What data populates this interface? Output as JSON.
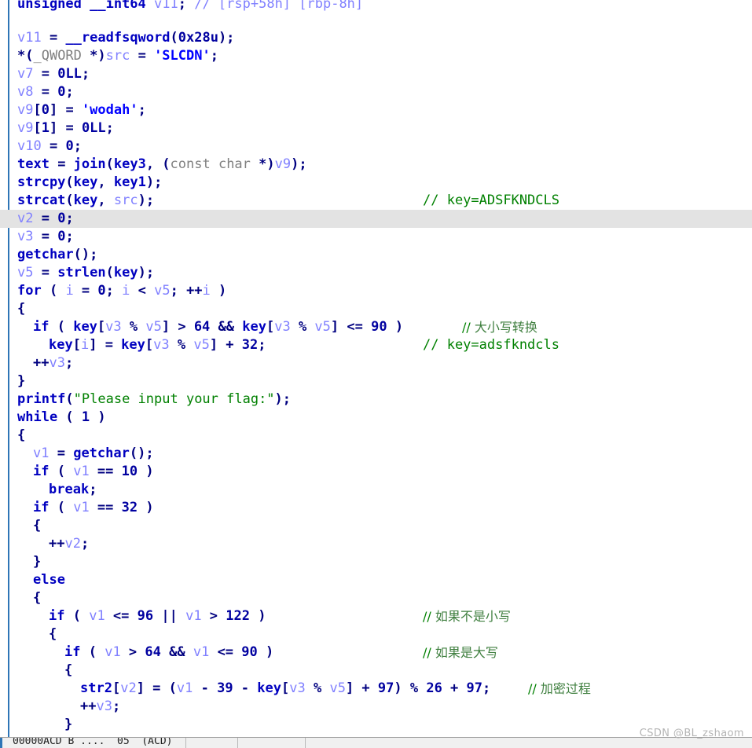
{
  "view": {
    "kind": "ida-pseudocode-pane",
    "highlighted_line_index": 11,
    "colors": {
      "background": "#ffffff",
      "highlight_row": "#e3e3e3",
      "left_rule": "#2e75b6",
      "keyword": "#0000c0",
      "local_variable": "#8080ff",
      "number": "#0000a0",
      "string": "#008000",
      "comment": "#008000",
      "type": "#808080",
      "punctuation": "#000080",
      "watermark": "#b4b4b4"
    }
  },
  "code_lines": [
    {
      "indent": 0,
      "clipped": true,
      "tokens": [
        {
          "t": "kw",
          "s": "unsigned __int64"
        },
        {
          "t": "pun",
          "s": " "
        },
        {
          "t": "var",
          "s": "v11"
        },
        {
          "t": "pun",
          "s": "; "
        },
        {
          "t": "cmtv",
          "s": "// [rsp+58h] [rbp-8h]"
        }
      ]
    },
    {
      "indent": 0,
      "tokens": []
    },
    {
      "indent": 0,
      "tokens": [
        {
          "t": "var",
          "s": "v11"
        },
        {
          "t": "pun",
          "s": " = "
        },
        {
          "t": "fn",
          "s": "__readfsqword"
        },
        {
          "t": "pun",
          "s": "("
        },
        {
          "t": "num",
          "s": "0x28u"
        },
        {
          "t": "pun",
          "s": ");"
        }
      ]
    },
    {
      "indent": 0,
      "tokens": [
        {
          "t": "pun",
          "s": "*("
        },
        {
          "t": "typ",
          "s": "_QWORD "
        },
        {
          "t": "pun",
          "s": "*)"
        },
        {
          "t": "var",
          "s": "src"
        },
        {
          "t": "pun",
          "s": " = "
        },
        {
          "t": "chr",
          "s": "'SLCDN'"
        },
        {
          "t": "pun",
          "s": ";"
        }
      ]
    },
    {
      "indent": 0,
      "tokens": [
        {
          "t": "var",
          "s": "v7"
        },
        {
          "t": "pun",
          "s": " = "
        },
        {
          "t": "num",
          "s": "0LL"
        },
        {
          "t": "pun",
          "s": ";"
        }
      ]
    },
    {
      "indent": 0,
      "tokens": [
        {
          "t": "var",
          "s": "v8"
        },
        {
          "t": "pun",
          "s": " = "
        },
        {
          "t": "num",
          "s": "0"
        },
        {
          "t": "pun",
          "s": ";"
        }
      ]
    },
    {
      "indent": 0,
      "tokens": [
        {
          "t": "var",
          "s": "v9"
        },
        {
          "t": "pun",
          "s": "["
        },
        {
          "t": "num",
          "s": "0"
        },
        {
          "t": "pun",
          "s": "] = "
        },
        {
          "t": "chr",
          "s": "'wodah'"
        },
        {
          "t": "pun",
          "s": ";"
        }
      ]
    },
    {
      "indent": 0,
      "tokens": [
        {
          "t": "var",
          "s": "v9"
        },
        {
          "t": "pun",
          "s": "["
        },
        {
          "t": "num",
          "s": "1"
        },
        {
          "t": "pun",
          "s": "] = "
        },
        {
          "t": "num",
          "s": "0LL"
        },
        {
          "t": "pun",
          "s": ";"
        }
      ]
    },
    {
      "indent": 0,
      "tokens": [
        {
          "t": "var",
          "s": "v10"
        },
        {
          "t": "pun",
          "s": " = "
        },
        {
          "t": "num",
          "s": "0"
        },
        {
          "t": "pun",
          "s": ";"
        }
      ]
    },
    {
      "indent": 0,
      "tokens": [
        {
          "t": "glb",
          "s": "text"
        },
        {
          "t": "pun",
          "s": " = "
        },
        {
          "t": "fn",
          "s": "join"
        },
        {
          "t": "pun",
          "s": "("
        },
        {
          "t": "glb",
          "s": "key3"
        },
        {
          "t": "pun",
          "s": ", ("
        },
        {
          "t": "typ",
          "s": "const char "
        },
        {
          "t": "pun",
          "s": "*)"
        },
        {
          "t": "var",
          "s": "v9"
        },
        {
          "t": "pun",
          "s": ");"
        }
      ]
    },
    {
      "indent": 0,
      "tokens": [
        {
          "t": "fn",
          "s": "strcpy"
        },
        {
          "t": "pun",
          "s": "("
        },
        {
          "t": "glb",
          "s": "key"
        },
        {
          "t": "pun",
          "s": ", "
        },
        {
          "t": "glb",
          "s": "key1"
        },
        {
          "t": "pun",
          "s": ");"
        }
      ]
    },
    {
      "indent": 0,
      "comment_col": 538,
      "comment": "// key=ADSFKNDCLS",
      "comment_type": "cmt",
      "tokens": [
        {
          "t": "fn",
          "s": "strcat"
        },
        {
          "t": "pun",
          "s": "("
        },
        {
          "t": "glb",
          "s": "key"
        },
        {
          "t": "pun",
          "s": ", "
        },
        {
          "t": "var",
          "s": "src"
        },
        {
          "t": "pun",
          "s": ");"
        }
      ]
    },
    {
      "indent": 0,
      "highlight": true,
      "tokens": [
        {
          "t": "var",
          "s": "v2"
        },
        {
          "t": "pun",
          "s": " = "
        },
        {
          "t": "num",
          "s": "0"
        },
        {
          "t": "pun",
          "s": ";"
        }
      ]
    },
    {
      "indent": 0,
      "tokens": [
        {
          "t": "var",
          "s": "v3"
        },
        {
          "t": "pun",
          "s": " = "
        },
        {
          "t": "num",
          "s": "0"
        },
        {
          "t": "pun",
          "s": ";"
        }
      ]
    },
    {
      "indent": 0,
      "tokens": [
        {
          "t": "fn",
          "s": "getchar"
        },
        {
          "t": "pun",
          "s": "();"
        }
      ]
    },
    {
      "indent": 0,
      "tokens": [
        {
          "t": "var",
          "s": "v5"
        },
        {
          "t": "pun",
          "s": " = "
        },
        {
          "t": "fn",
          "s": "strlen"
        },
        {
          "t": "pun",
          "s": "("
        },
        {
          "t": "glb",
          "s": "key"
        },
        {
          "t": "pun",
          "s": ");"
        }
      ]
    },
    {
      "indent": 0,
      "tokens": [
        {
          "t": "kw",
          "s": "for"
        },
        {
          "t": "pun",
          "s": " ( "
        },
        {
          "t": "var",
          "s": "i"
        },
        {
          "t": "pun",
          "s": " = "
        },
        {
          "t": "num",
          "s": "0"
        },
        {
          "t": "pun",
          "s": "; "
        },
        {
          "t": "var",
          "s": "i"
        },
        {
          "t": "pun",
          "s": " < "
        },
        {
          "t": "var",
          "s": "v5"
        },
        {
          "t": "pun",
          "s": "; ++"
        },
        {
          "t": "var",
          "s": "i"
        },
        {
          "t": "pun",
          "s": " )"
        }
      ]
    },
    {
      "indent": 0,
      "tokens": [
        {
          "t": "pun",
          "s": "{"
        }
      ]
    },
    {
      "indent": 1,
      "comment_col": 588,
      "comment": "// 大小写转换",
      "comment_type": "cn",
      "tokens": [
        {
          "t": "kw",
          "s": "if"
        },
        {
          "t": "pun",
          "s": " ( "
        },
        {
          "t": "glb",
          "s": "key"
        },
        {
          "t": "pun",
          "s": "["
        },
        {
          "t": "var",
          "s": "v3"
        },
        {
          "t": "pun",
          "s": " % "
        },
        {
          "t": "var",
          "s": "v5"
        },
        {
          "t": "pun",
          "s": "] > "
        },
        {
          "t": "num",
          "s": "64"
        },
        {
          "t": "pun",
          "s": " && "
        },
        {
          "t": "glb",
          "s": "key"
        },
        {
          "t": "pun",
          "s": "["
        },
        {
          "t": "var",
          "s": "v3"
        },
        {
          "t": "pun",
          "s": " % "
        },
        {
          "t": "var",
          "s": "v5"
        },
        {
          "t": "pun",
          "s": "] <= "
        },
        {
          "t": "num",
          "s": "90"
        },
        {
          "t": "pun",
          "s": " )"
        }
      ]
    },
    {
      "indent": 2,
      "comment_col": 538,
      "comment": "// key=adsfkndcls",
      "comment_type": "cmt",
      "tokens": [
        {
          "t": "glb",
          "s": "key"
        },
        {
          "t": "pun",
          "s": "["
        },
        {
          "t": "var",
          "s": "i"
        },
        {
          "t": "pun",
          "s": "] = "
        },
        {
          "t": "glb",
          "s": "key"
        },
        {
          "t": "pun",
          "s": "["
        },
        {
          "t": "var",
          "s": "v3"
        },
        {
          "t": "pun",
          "s": " % "
        },
        {
          "t": "var",
          "s": "v5"
        },
        {
          "t": "pun",
          "s": "] + "
        },
        {
          "t": "num",
          "s": "32"
        },
        {
          "t": "pun",
          "s": ";"
        }
      ]
    },
    {
      "indent": 1,
      "tokens": [
        {
          "t": "pun",
          "s": "++"
        },
        {
          "t": "var",
          "s": "v3"
        },
        {
          "t": "pun",
          "s": ";"
        }
      ]
    },
    {
      "indent": 0,
      "tokens": [
        {
          "t": "pun",
          "s": "}"
        }
      ]
    },
    {
      "indent": 0,
      "tokens": [
        {
          "t": "fn",
          "s": "printf"
        },
        {
          "t": "pun",
          "s": "("
        },
        {
          "t": "str",
          "s": "\"Please input your flag:\""
        },
        {
          "t": "pun",
          "s": ");"
        }
      ]
    },
    {
      "indent": 0,
      "tokens": [
        {
          "t": "kw",
          "s": "while"
        },
        {
          "t": "pun",
          "s": " ( "
        },
        {
          "t": "num",
          "s": "1"
        },
        {
          "t": "pun",
          "s": " )"
        }
      ]
    },
    {
      "indent": 0,
      "tokens": [
        {
          "t": "pun",
          "s": "{"
        }
      ]
    },
    {
      "indent": 1,
      "tokens": [
        {
          "t": "var",
          "s": "v1"
        },
        {
          "t": "pun",
          "s": " = "
        },
        {
          "t": "fn",
          "s": "getchar"
        },
        {
          "t": "pun",
          "s": "();"
        }
      ]
    },
    {
      "indent": 1,
      "tokens": [
        {
          "t": "kw",
          "s": "if"
        },
        {
          "t": "pun",
          "s": " ( "
        },
        {
          "t": "var",
          "s": "v1"
        },
        {
          "t": "pun",
          "s": " == "
        },
        {
          "t": "num",
          "s": "10"
        },
        {
          "t": "pun",
          "s": " )"
        }
      ]
    },
    {
      "indent": 2,
      "tokens": [
        {
          "t": "kw",
          "s": "break"
        },
        {
          "t": "pun",
          "s": ";"
        }
      ]
    },
    {
      "indent": 1,
      "tokens": [
        {
          "t": "kw",
          "s": "if"
        },
        {
          "t": "pun",
          "s": " ( "
        },
        {
          "t": "var",
          "s": "v1"
        },
        {
          "t": "pun",
          "s": " == "
        },
        {
          "t": "num",
          "s": "32"
        },
        {
          "t": "pun",
          "s": " )"
        }
      ]
    },
    {
      "indent": 1,
      "tokens": [
        {
          "t": "pun",
          "s": "{"
        }
      ]
    },
    {
      "indent": 2,
      "tokens": [
        {
          "t": "pun",
          "s": "++"
        },
        {
          "t": "var",
          "s": "v2"
        },
        {
          "t": "pun",
          "s": ";"
        }
      ]
    },
    {
      "indent": 1,
      "tokens": [
        {
          "t": "pun",
          "s": "}"
        }
      ]
    },
    {
      "indent": 1,
      "tokens": [
        {
          "t": "kw",
          "s": "else"
        }
      ]
    },
    {
      "indent": 1,
      "tokens": [
        {
          "t": "pun",
          "s": "{"
        }
      ]
    },
    {
      "indent": 2,
      "comment_col": 538,
      "comment": "// 如果不是小写",
      "comment_type": "cn",
      "tokens": [
        {
          "t": "kw",
          "s": "if"
        },
        {
          "t": "pun",
          "s": " ( "
        },
        {
          "t": "var",
          "s": "v1"
        },
        {
          "t": "pun",
          "s": " <= "
        },
        {
          "t": "num",
          "s": "96"
        },
        {
          "t": "pun",
          "s": " || "
        },
        {
          "t": "var",
          "s": "v1"
        },
        {
          "t": "pun",
          "s": " > "
        },
        {
          "t": "num",
          "s": "122"
        },
        {
          "t": "pun",
          "s": " )"
        }
      ]
    },
    {
      "indent": 2,
      "tokens": [
        {
          "t": "pun",
          "s": "{"
        }
      ]
    },
    {
      "indent": 3,
      "comment_col": 538,
      "comment": "// 如果是大写",
      "comment_type": "cn",
      "tokens": [
        {
          "t": "kw",
          "s": "if"
        },
        {
          "t": "pun",
          "s": " ( "
        },
        {
          "t": "var",
          "s": "v1"
        },
        {
          "t": "pun",
          "s": " > "
        },
        {
          "t": "num",
          "s": "64"
        },
        {
          "t": "pun",
          "s": " && "
        },
        {
          "t": "var",
          "s": "v1"
        },
        {
          "t": "pun",
          "s": " <= "
        },
        {
          "t": "num",
          "s": "90"
        },
        {
          "t": "pun",
          "s": " )"
        }
      ]
    },
    {
      "indent": 3,
      "tokens": [
        {
          "t": "pun",
          "s": "{"
        }
      ]
    },
    {
      "indent": 4,
      "comment_col": 672,
      "comment": "// 加密过程",
      "comment_type": "cn",
      "tokens": [
        {
          "t": "glb",
          "s": "str2"
        },
        {
          "t": "pun",
          "s": "["
        },
        {
          "t": "var",
          "s": "v2"
        },
        {
          "t": "pun",
          "s": "] = ("
        },
        {
          "t": "var",
          "s": "v1"
        },
        {
          "t": "pun",
          "s": " - "
        },
        {
          "t": "num",
          "s": "39"
        },
        {
          "t": "pun",
          "s": " - "
        },
        {
          "t": "glb",
          "s": "key"
        },
        {
          "t": "pun",
          "s": "["
        },
        {
          "t": "var",
          "s": "v3"
        },
        {
          "t": "pun",
          "s": " % "
        },
        {
          "t": "var",
          "s": "v5"
        },
        {
          "t": "pun",
          "s": "] + "
        },
        {
          "t": "num",
          "s": "97"
        },
        {
          "t": "pun",
          "s": ") % "
        },
        {
          "t": "num",
          "s": "26"
        },
        {
          "t": "pun",
          "s": " + "
        },
        {
          "t": "num",
          "s": "97"
        },
        {
          "t": "pun",
          "s": ";"
        }
      ]
    },
    {
      "indent": 4,
      "tokens": [
        {
          "t": "pun",
          "s": "++"
        },
        {
          "t": "var",
          "s": "v3"
        },
        {
          "t": "pun",
          "s": ";"
        }
      ]
    },
    {
      "indent": 3,
      "tokens": [
        {
          "t": "pun",
          "s": "}"
        }
      ]
    },
    {
      "indent": 3,
      "clipped_bottom": true,
      "tokens": [
        {
          "t": "pun",
          "s": ","
        }
      ]
    }
  ],
  "bottom_bar": {
    "cells": [
      {
        "x": 16,
        "text": "00000ACD B ....  05  (ACD)"
      }
    ],
    "separators": [
      236,
      302,
      388
    ]
  },
  "watermark": "CSDN @BL_zshaom"
}
